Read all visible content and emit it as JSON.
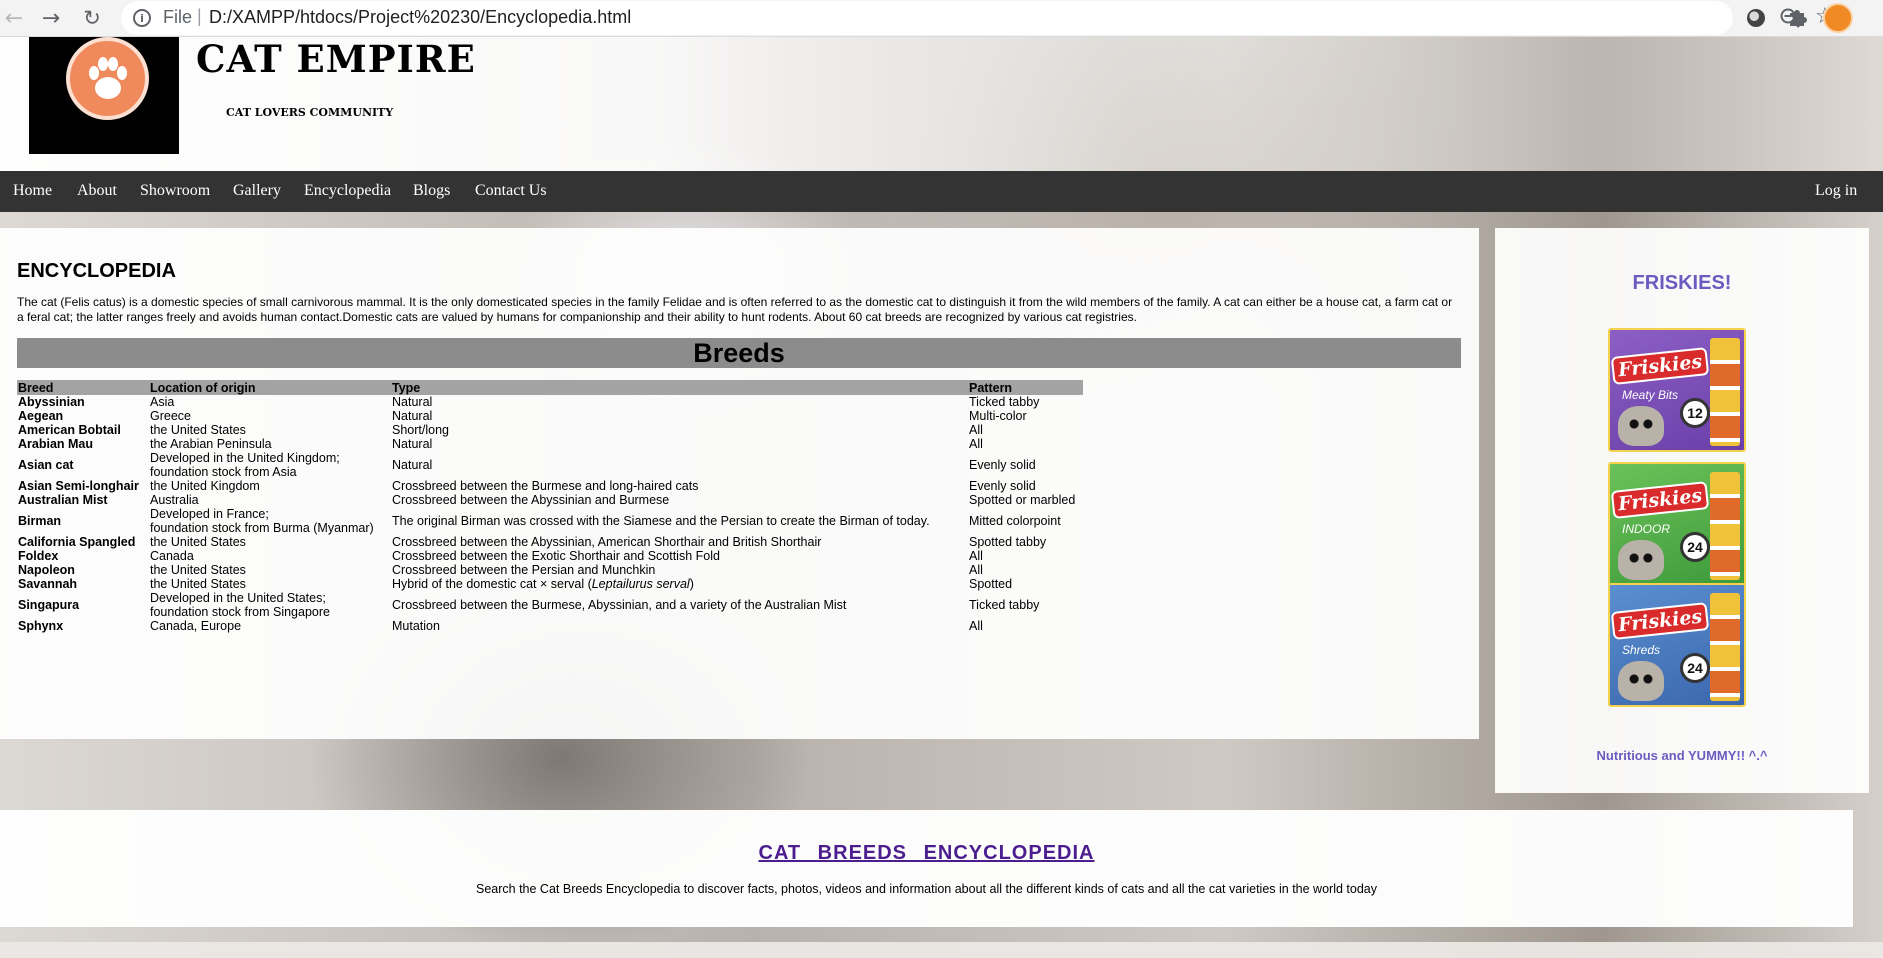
{
  "browser": {
    "scheme": "File",
    "url": "D:/XAMPP/htdocs/Project%20230/Encyclopedia.html"
  },
  "site": {
    "title": "CAT EMPIRE",
    "subtitle": "CAT LOVERS COMMUNITY"
  },
  "nav": {
    "items": [
      "Home",
      "About",
      "Showroom",
      "Gallery",
      "Encyclopedia",
      "Blogs",
      "Contact Us"
    ],
    "login": "Log in"
  },
  "encyclopedia": {
    "heading": "ENCYCLOPEDIA",
    "intro": "The cat (Felis catus) is a domestic species of small carnivorous mammal. It is the only domesticated species in the family Felidae and is often referred to as the domestic cat to distinguish it from the wild members of the family. A cat can either be a house cat, a farm cat or a feral cat; the latter ranges freely and avoids human contact.Domestic cats are valued by humans for companionship and their ability to hunt rodents. About 60 cat breeds are recognized by various cat registries.",
    "breeds_heading": "Breeds",
    "columns": [
      "Breed",
      "Location of origin",
      "Type",
      "Pattern"
    ],
    "rows": [
      {
        "breed": "Abyssinian",
        "origin": "Asia",
        "type": "Natural",
        "pattern": "Ticked tabby"
      },
      {
        "breed": "Aegean",
        "origin": "Greece",
        "type": "Natural",
        "pattern": "Multi-color"
      },
      {
        "breed": "American Bobtail",
        "origin": "the United States",
        "type": "Short/long",
        "pattern": "All"
      },
      {
        "breed": "Arabian Mau",
        "origin": "the Arabian Peninsula",
        "type": "Natural",
        "pattern": "All"
      },
      {
        "breed": "Asian cat",
        "origin": "Developed in the United Kingdom;",
        "origin2": "foundation stock from Asia",
        "type": "Natural",
        "pattern": "Evenly solid"
      },
      {
        "breed": "Asian Semi-longhair",
        "origin": "the United Kingdom",
        "type": "Crossbreed between the Burmese and long-haired cats",
        "pattern": "Evenly solid"
      },
      {
        "breed": "Australian Mist",
        "origin": "Australia",
        "type": "Crossbreed between the Abyssinian and Burmese",
        "pattern": "Spotted or marbled"
      },
      {
        "breed": "Birman",
        "origin": "Developed in France;",
        "origin2": "foundation stock from Burma (Myanmar)",
        "type": "The original Birman was crossed with the Siamese and the Persian to create the Birman of today.",
        "pattern": "Mitted colorpoint"
      },
      {
        "breed": "California Spangled",
        "origin": "the United States",
        "type": "Crossbreed between the Abyssinian, American Shorthair and British Shorthair",
        "pattern": "Spotted tabby"
      },
      {
        "breed": "Foldex",
        "origin": "Canada",
        "type": "Crossbreed between the Exotic Shorthair and Scottish Fold",
        "pattern": "All"
      },
      {
        "breed": "Napoleon",
        "origin": "the United States",
        "type": "Crossbreed between the Persian and Munchkin",
        "pattern": "All"
      },
      {
        "breed": "Savannah",
        "origin": "the United States",
        "type": "Hybrid of the domestic cat × serval (",
        "type_italic": "Leptailurus serval",
        "type_end": ")",
        "pattern": "Spotted"
      },
      {
        "breed": "Singapura",
        "origin": "Developed in the United States;",
        "origin2": "foundation stock from Singapore",
        "type": "Crossbreed between the Burmese, Abyssinian, and a variety of the Australian Mist",
        "pattern": "Ticked tabby"
      },
      {
        "breed": "Sphynx",
        "origin": "Canada, Europe",
        "type": "Mutation",
        "pattern": "All"
      }
    ]
  },
  "sidebar": {
    "title": "FRISKIES!",
    "products": [
      {
        "brand": "Friskies",
        "variant": "Meaty Bits",
        "count": "12"
      },
      {
        "brand": "Friskies",
        "variant": "INDOOR",
        "count": "24"
      },
      {
        "brand": "Friskies",
        "variant": "Shreds",
        "count": "24"
      }
    ],
    "tagline": "Nutritious and YUMMY!! ^.^"
  },
  "footer": {
    "link": "CAT BREEDS ENCYCLOPEDIA",
    "text": "Search the Cat Breeds Encyclopedia to discover facts, photos, videos and information about all the different kinds of cats and all the cat varieties in the world today"
  }
}
